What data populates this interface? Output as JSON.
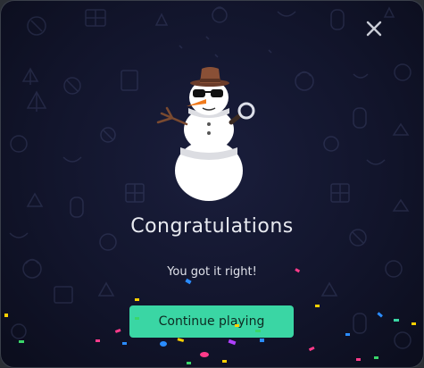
{
  "dialog": {
    "title": "Congratulations",
    "message": "You got it right!",
    "continue_label": "Continue playing"
  },
  "icons": {
    "close": "close-icon",
    "illustration": "snowman-illustration"
  },
  "colors": {
    "background": "#12152c",
    "accent": "#3ad6a4",
    "title_text": "#e8eaf0"
  }
}
